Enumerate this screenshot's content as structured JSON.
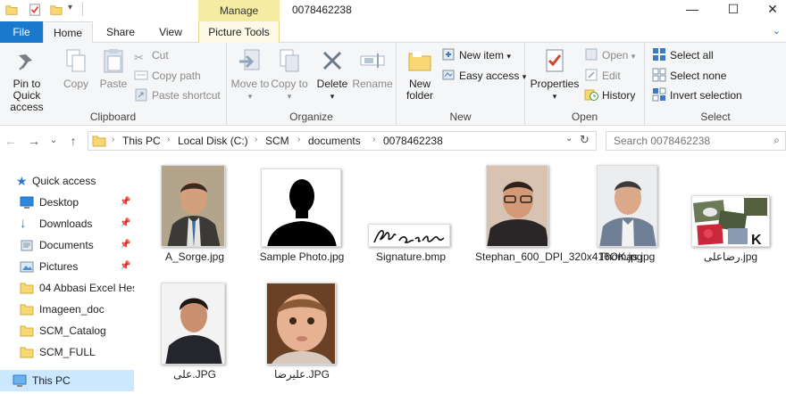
{
  "window": {
    "title": "0078462238",
    "context_tab": "Manage",
    "minimize_glyph": "—",
    "maximize_glyph": "☐",
    "close_glyph": "✕"
  },
  "tabs": {
    "file": "File",
    "home": "Home",
    "share": "Share",
    "view": "View",
    "picture_tools": "Picture Tools"
  },
  "ribbon": {
    "clipboard": {
      "label": "Clipboard",
      "pin": "Pin to Quick access",
      "copy": "Copy",
      "paste": "Paste",
      "cut": "Cut",
      "copy_path": "Copy path",
      "paste_shortcut": "Paste shortcut"
    },
    "organize": {
      "label": "Organize",
      "move_to": "Move to",
      "copy_to": "Copy to",
      "delete": "Delete",
      "rename": "Rename"
    },
    "new": {
      "label": "New",
      "new_folder": "New folder",
      "new_item": "New item",
      "easy_access": "Easy access"
    },
    "open": {
      "label": "Open",
      "properties": "Properties",
      "open": "Open",
      "edit": "Edit",
      "history": "History"
    },
    "select": {
      "label": "Select",
      "select_all": "Select all",
      "select_none": "Select none",
      "invert": "Invert selection"
    }
  },
  "address": {
    "crumbs": [
      "This PC",
      "Local Disk (C:)",
      "SCM",
      "documents",
      "0078462238"
    ],
    "search_placeholder": "Search 0078462238"
  },
  "navpane": {
    "items": [
      {
        "label": "Quick access",
        "icon": "star-icon",
        "pinned": false
      },
      {
        "label": "Desktop",
        "icon": "desktop-icon",
        "pinned": true
      },
      {
        "label": "Downloads",
        "icon": "download-icon",
        "pinned": true
      },
      {
        "label": "Documents",
        "icon": "documents-icon",
        "pinned": true
      },
      {
        "label": "Pictures",
        "icon": "pictures-icon",
        "pinned": true
      },
      {
        "label": "04 Abbasi Excel Hes",
        "icon": "folder-icon",
        "pinned": false
      },
      {
        "label": "Imageen_doc",
        "icon": "folder-icon",
        "pinned": false
      },
      {
        "label": "SCM_Catalog",
        "icon": "folder-icon",
        "pinned": false
      },
      {
        "label": "SCM_FULL",
        "icon": "folder-icon",
        "pinned": false
      },
      {
        "label": "This PC",
        "icon": "computer-icon",
        "pinned": false
      }
    ],
    "pin_glyph": "📌"
  },
  "files": [
    {
      "name": "A_Sorge.jpg",
      "kind": "portrait-man-suit"
    },
    {
      "name": "Sample Photo.jpg",
      "kind": "silhouette"
    },
    {
      "name": "Signature.bmp",
      "kind": "signature"
    },
    {
      "name": "Stephan_600_DPI_320x416OK.jpg",
      "kind": "portrait-man-glasses"
    },
    {
      "name": "Thomas.jpg",
      "kind": "portrait-man-grey"
    },
    {
      "name": "رضاعلی.jpg",
      "kind": "collage"
    },
    {
      "name": "علی.JPG",
      "kind": "portrait-young-man"
    },
    {
      "name": "علیرضا.JPG",
      "kind": "portrait-baby"
    }
  ],
  "colors": {
    "file_tab": "#1979ca",
    "manage_tab": "#f6eda4",
    "selection": "#cce8ff",
    "folder": "#f8d775"
  }
}
